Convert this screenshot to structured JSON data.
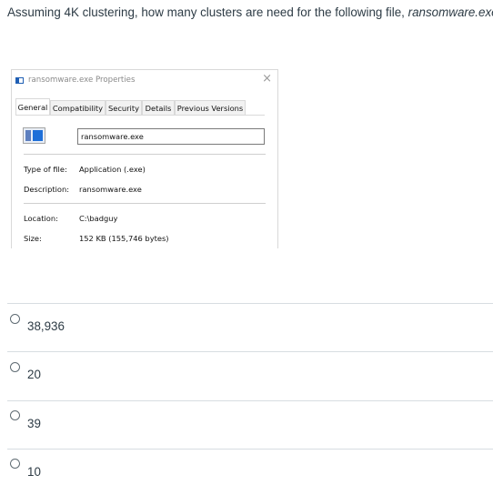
{
  "question": {
    "text": "Assuming 4K clustering, how many clusters are need for the following file, ",
    "filename": "ransomware.exe?"
  },
  "dialog": {
    "title": "ransomware.exe Properties",
    "close_glyph": "×",
    "tabs": [
      "General",
      "Compatibility",
      "Security",
      "Details",
      "Previous Versions"
    ],
    "filename_value": "ransomware.exe",
    "type_label": "Type of file:",
    "type_value": "Application (.exe)",
    "description_label": "Description:",
    "description_value": "ransomware.exe",
    "location_label": "Location:",
    "location_value": "C:\\badguy",
    "size_label": "Size:",
    "size_value": "152 KB (155,746 bytes)"
  },
  "answers": [
    "38,936",
    "20",
    "39",
    "10"
  ]
}
